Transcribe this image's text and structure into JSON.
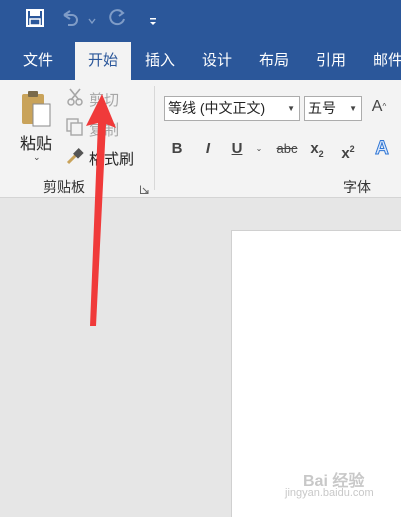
{
  "quick_access": {
    "icons": [
      "save-icon",
      "undo-icon",
      "undo-dropdown-icon",
      "redo-icon",
      "customize-qat-icon"
    ]
  },
  "tabs": [
    {
      "label": "文件"
    },
    {
      "label": "开始"
    },
    {
      "label": "插入"
    },
    {
      "label": "设计"
    },
    {
      "label": "布局"
    },
    {
      "label": "引用"
    },
    {
      "label": "邮件"
    }
  ],
  "active_tab": "开始",
  "clipboard": {
    "paste_label": "粘贴",
    "paste_dropdown": "⌄",
    "cut_label": "剪切",
    "copy_label": "复制",
    "format_painter_label": "格式刷",
    "group_label": "剪贴板"
  },
  "font": {
    "font_name": "等线 (中文正文)",
    "font_size": "五号",
    "grow_font_glyph": "A",
    "bold": "B",
    "italic": "I",
    "underline": "U",
    "strikethrough": "abc",
    "subscript": "x",
    "subscript_sub": "2",
    "superscript": "x",
    "superscript_sup": "2",
    "text_effects": "A",
    "group_label": "字体"
  },
  "colors": {
    "title_bar": "#2b579a",
    "ribbon": "#f3f3f3",
    "annotation_arrow": "#f03a3a"
  },
  "watermark": {
    "brand": "Bai 经验",
    "url": "jingyan.baidu.com"
  }
}
